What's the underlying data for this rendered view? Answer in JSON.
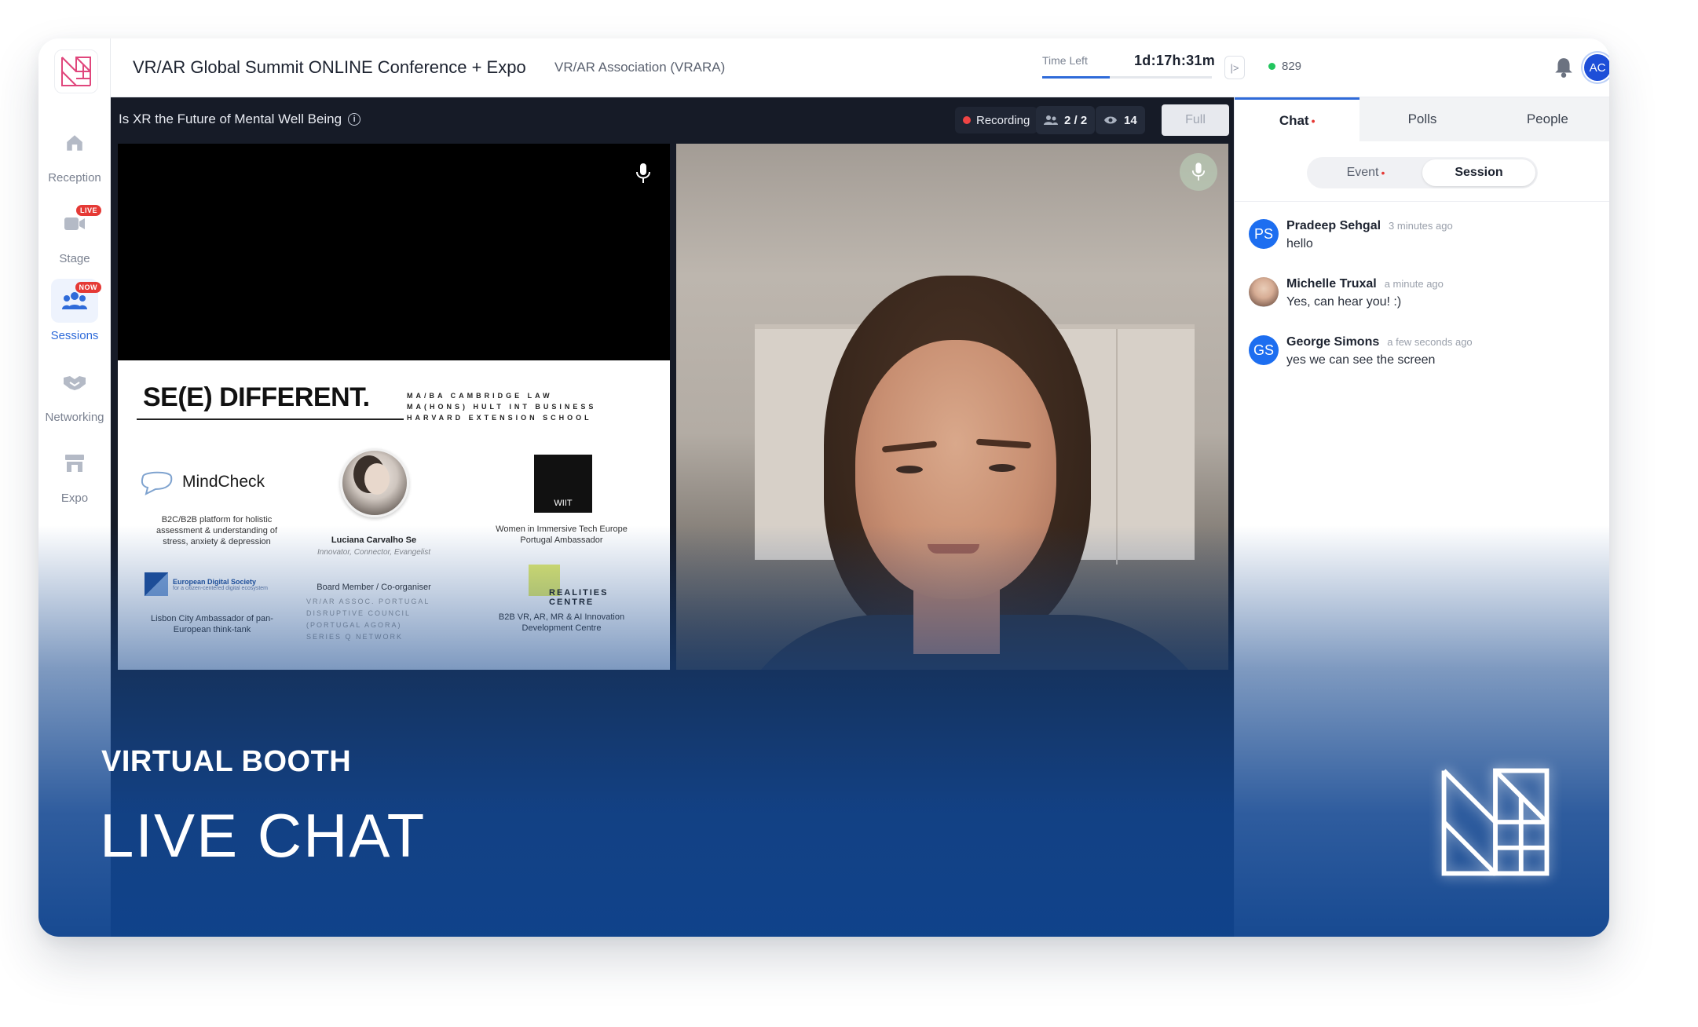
{
  "app": {
    "event_title": "VR/AR Global Summit ONLINE Conference + Expo",
    "organizer": "VR/AR Association (VRARA)",
    "time_left_label": "Time Left",
    "time_left_value": "1d:17h:31m",
    "time_progress_fraction": 0.4,
    "online_count": "829",
    "user_initials": "AC"
  },
  "sidebar": {
    "items": [
      {
        "label": "Reception",
        "icon": "home-icon",
        "badge": ""
      },
      {
        "label": "Stage",
        "icon": "camera-icon",
        "badge": "LIVE"
      },
      {
        "label": "Sessions",
        "icon": "people-icon",
        "badge": "NOW"
      },
      {
        "label": "Networking",
        "icon": "handshake-icon",
        "badge": ""
      },
      {
        "label": "Expo",
        "icon": "store-icon",
        "badge": ""
      }
    ]
  },
  "session": {
    "title": "Is XR the Future of Mental Well Being",
    "recording_label": "Recording",
    "participants": "2 / 2",
    "viewers": "14",
    "full_label": "Full"
  },
  "slide": {
    "title": "SE(E) DIFFERENT.",
    "quals": [
      "MA/BA CAMBRIDGE LAW",
      "MA(HONS) HULT INT BUSINESS",
      "HARVARD EXTENSION SCHOOL"
    ],
    "mindcheck_name": "MindCheck",
    "mindcheck_desc": "B2C/B2B platform for holistic assessment & understanding of stress, anxiety & depression",
    "person_name": "Luciana Carvalho Se",
    "person_role": "Innovator, Connector, Evangelist",
    "wiit_label": "WIIT",
    "wiit_desc": "Women in Immersive Tech Europe Portugal Ambassador",
    "eds_name": "European Digital Society",
    "eds_tagline": "for a citizen-centered digital ecosystem",
    "eds_desc": "Lisbon City Ambassador of pan-European think-tank",
    "board_label": "Board Member / Co-organiser",
    "board_orgs": [
      "VR/AR ASSOC. PORTUGAL",
      "DISRUPTIVE COUNCIL",
      "(PORTUGAL AGORA)",
      "SERIES Q NETWORK"
    ],
    "realities_name": "REALITIES CENTRE",
    "realities_desc": "B2B VR, AR, MR & AI Innovation Development Centre"
  },
  "marketing": {
    "subtitle": "VIRTUAL BOOTH",
    "headline": "LIVE CHAT"
  },
  "panel": {
    "tabs": [
      {
        "label": "Chat",
        "active": true,
        "dot": true
      },
      {
        "label": "Polls",
        "active": false,
        "dot": false
      },
      {
        "label": "People",
        "active": false,
        "dot": false
      }
    ],
    "subtabs": [
      {
        "label": "Event",
        "active": false,
        "dot": true
      },
      {
        "label": "Session",
        "active": true,
        "dot": false
      }
    ],
    "messages": [
      {
        "initials": "PS",
        "name": "Pradeep Sehgal",
        "time": "3 minutes ago",
        "text": "hello",
        "photo": false
      },
      {
        "initials": "",
        "name": "Michelle Truxal",
        "time": "a minute ago",
        "text": "Yes, can hear you! :)",
        "photo": true
      },
      {
        "initials": "GS",
        "name": "George Simons",
        "time": "a few seconds ago",
        "text": "yes we can see the screen",
        "photo": false
      }
    ]
  },
  "colors": {
    "accent": "#2f6bd9",
    "brand_pink": "#e0467c",
    "recording": "#ef4444",
    "online": "#22c55e",
    "marketing_blue": "#10448e"
  }
}
